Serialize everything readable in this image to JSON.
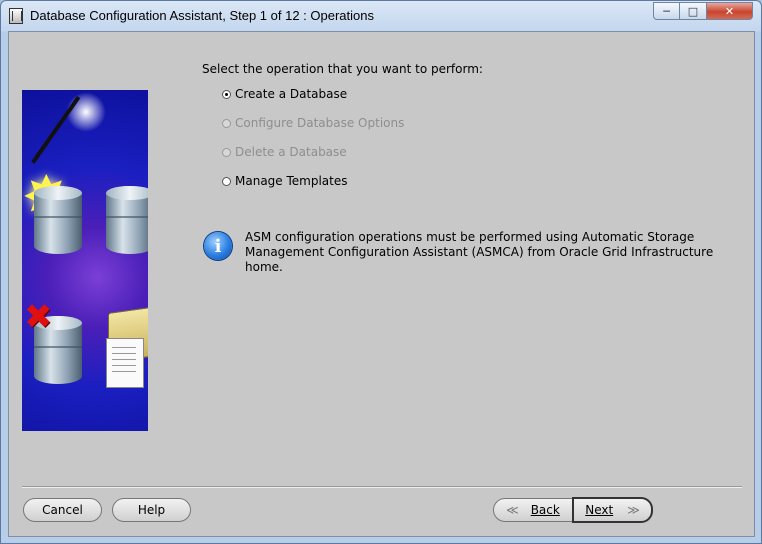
{
  "window": {
    "title": "Database Configuration Assistant, Step 1 of 12 : Operations",
    "controls": {
      "minimize": "─",
      "maximize": "□",
      "close": "✕"
    }
  },
  "main": {
    "prompt": "Select the operation that you want to perform:",
    "options": [
      {
        "label": "Create a Database",
        "selected": true,
        "enabled": true
      },
      {
        "label": "Configure Database Options",
        "selected": false,
        "enabled": false
      },
      {
        "label": "Delete a Database",
        "selected": false,
        "enabled": false
      },
      {
        "label": "Manage Templates",
        "selected": false,
        "enabled": true
      }
    ],
    "info": {
      "icon": "i",
      "line1": "ASM configuration operations must be performed using Automatic Storage",
      "line2": "Management Configuration Assistant (ASMCA) from Oracle Grid Infrastructure home."
    }
  },
  "footer": {
    "cancel": "Cancel",
    "help": "Help",
    "back": "Back",
    "next": "Next",
    "back_arrow": "≪",
    "next_arrow": "≫"
  }
}
